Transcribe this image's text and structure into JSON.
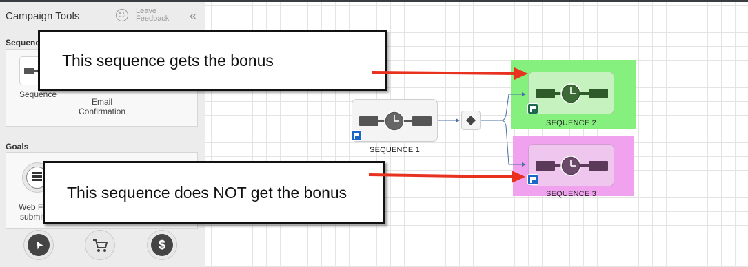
{
  "sidebar": {
    "title": "Campaign Tools",
    "feedback_label": "Leave Feedback",
    "collapse_glyph": "«",
    "sequences_heading": "Sequences",
    "tools": [
      {
        "label": "Sequence",
        "icon": "sequence-icon"
      },
      {
        "label": "Email Confirmation",
        "icon": "email-confirmation-icon"
      }
    ],
    "goals_heading": "Goals",
    "goal_items": [
      {
        "label": "Web Form submitted",
        "icon": "web-form-icon"
      }
    ],
    "round_icons": [
      {
        "name": "cursor-icon",
        "glyph": "➤"
      },
      {
        "name": "cart-icon",
        "glyph": "🛒"
      },
      {
        "name": "dollar-icon",
        "glyph": "$"
      }
    ]
  },
  "canvas": {
    "sequences": [
      {
        "label": "SEQUENCE 1",
        "highlight": null
      },
      {
        "label": "SEQUENCE 2",
        "highlight": "#7df07a"
      },
      {
        "label": "SEQUENCE 3",
        "highlight": "#f3a0f1"
      }
    ],
    "split_icon": "diamond-split-icon",
    "callouts": [
      {
        "text": "This sequence gets the bonus"
      },
      {
        "text": "This sequence does NOT get the bonus"
      }
    ],
    "colors": {
      "arrow": "#e8321f",
      "flag": "#1a67c8",
      "connector": "#4a6fa5",
      "callout_border": "#111111"
    }
  }
}
